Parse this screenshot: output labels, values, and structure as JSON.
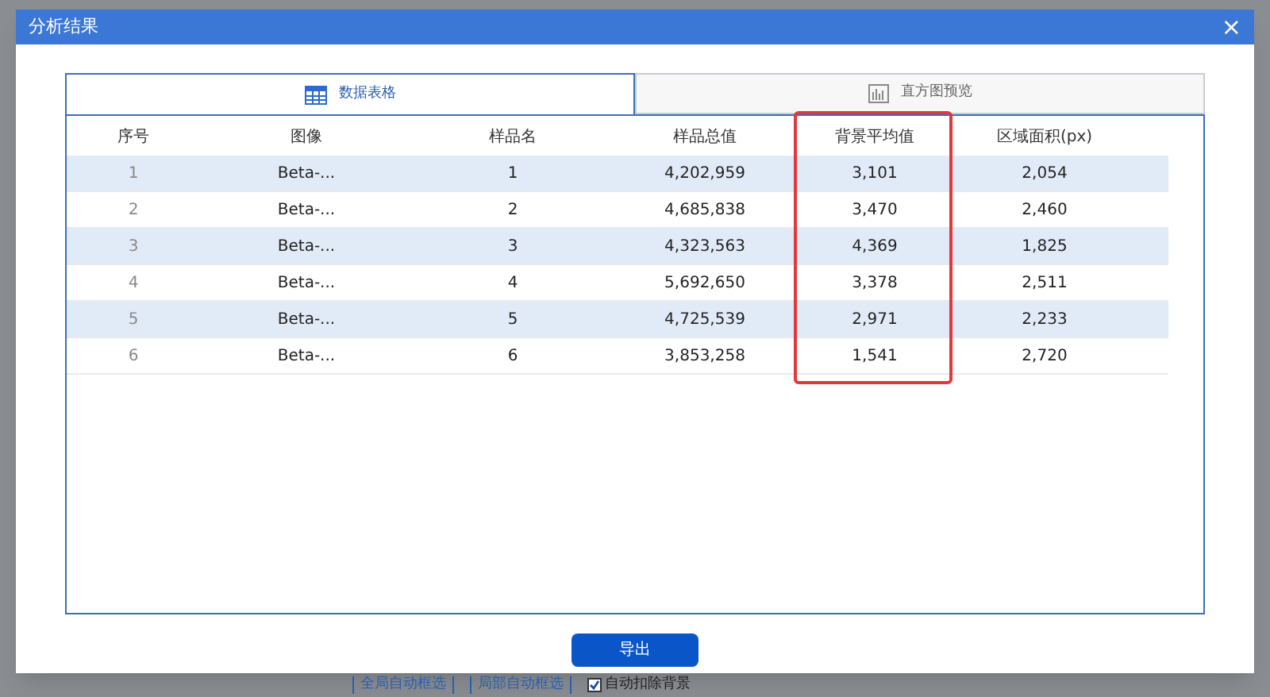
{
  "dialog": {
    "title": "分析结果",
    "close": "×"
  },
  "tabs": [
    {
      "label": "数据表格",
      "kind": "table",
      "selected": true
    },
    {
      "label": "直方图预览",
      "kind": "chart",
      "selected": false
    }
  ],
  "table": {
    "columns": [
      {
        "label": "序号",
        "highlighted": false
      },
      {
        "label": "图像",
        "highlighted": false
      },
      {
        "label": "样品名",
        "highlighted": false
      },
      {
        "label": "样品总值",
        "highlighted": false
      },
      {
        "label": "背景平均值",
        "highlighted": true
      },
      {
        "label": "区域面积(px)",
        "highlighted": false
      }
    ],
    "rows": [
      [
        "1",
        "Beta-...",
        "1",
        "4,202,959",
        "3,101",
        "2,054"
      ],
      [
        "2",
        "Beta-...",
        "2",
        "4,685,838",
        "3,470",
        "2,460"
      ],
      [
        "3",
        "Beta-...",
        "3",
        "4,323,563",
        "4,369",
        "1,825"
      ],
      [
        "4",
        "Beta-...",
        "4",
        "5,692,650",
        "3,378",
        "2,511"
      ],
      [
        "5",
        "Beta-...",
        "5",
        "4,725,539",
        "2,971",
        "2,233"
      ],
      [
        "6",
        "Beta-...",
        "6",
        "3,853,258",
        "1,541",
        "2,720"
      ]
    ]
  },
  "buttons": [
    "导出"
  ],
  "background_toolbar": [
    {
      "kind": "button",
      "label": "全局自动框选"
    },
    {
      "kind": "button",
      "label": "局部自动框选"
    },
    {
      "kind": "checkbox",
      "label": "自动扣除背景",
      "checked": true
    }
  ]
}
